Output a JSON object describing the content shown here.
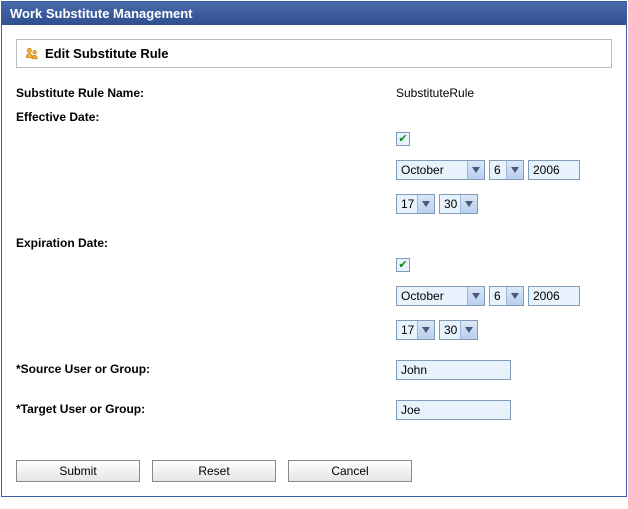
{
  "header": {
    "title": "Work Substitute Management"
  },
  "panel": {
    "title": "Edit Substitute Rule"
  },
  "labels": {
    "rule_name": "Substitute Rule Name:",
    "effective": "Effective Date:",
    "expiration": "Expiration Date:",
    "source": "*Source User or Group:",
    "target": "*Target User or Group:"
  },
  "values": {
    "rule_name": "SubstituteRule",
    "source": "John",
    "target": "Joe"
  },
  "effective_date": {
    "enabled": true,
    "check_glyph": "✔",
    "month": "October",
    "day": "6",
    "year": "2006",
    "hour": "17",
    "minute": "30"
  },
  "expiration_date": {
    "enabled": true,
    "check_glyph": "✔",
    "month": "October",
    "day": "6",
    "year": "2006",
    "hour": "17",
    "minute": "30"
  },
  "buttons": {
    "submit": "Submit",
    "reset": "Reset",
    "cancel": "Cancel"
  },
  "select_widths": {
    "month": 70,
    "day": 16,
    "hm": 20
  }
}
